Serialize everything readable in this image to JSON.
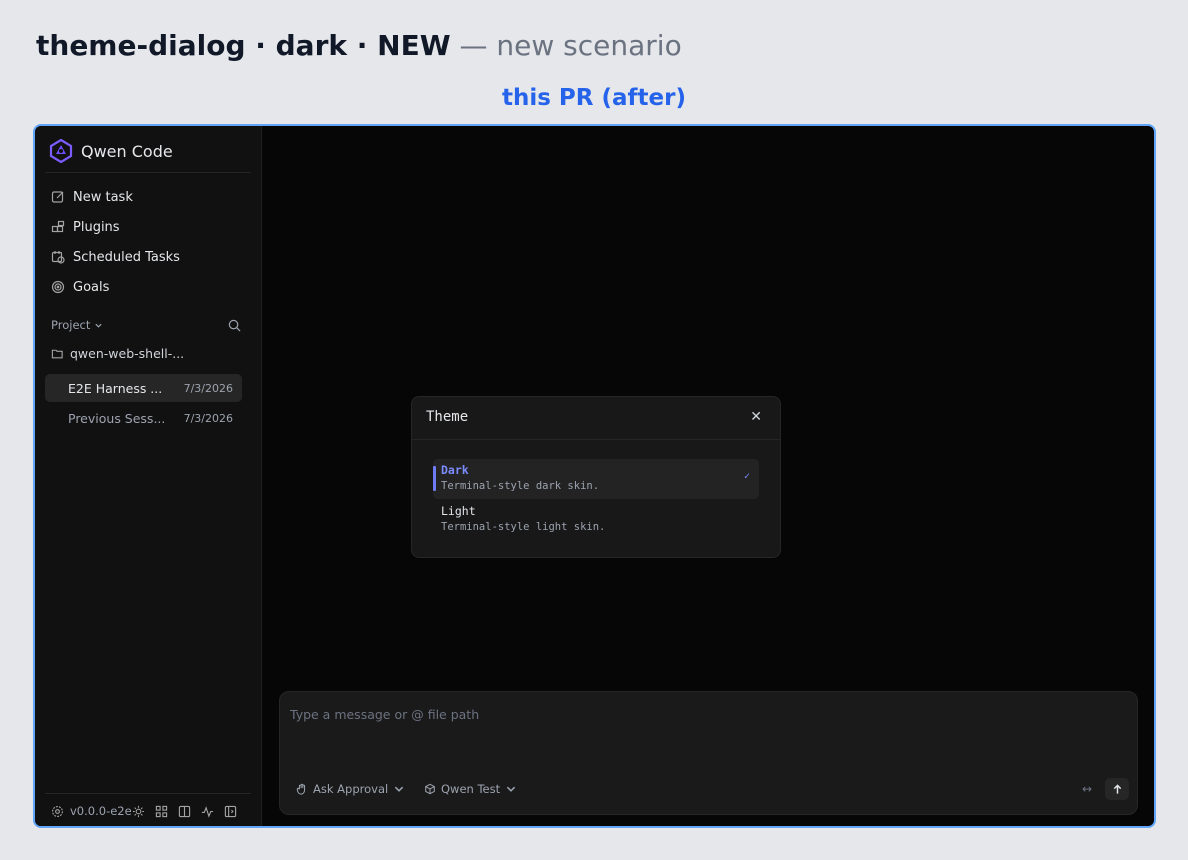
{
  "page": {
    "heading_main": "theme-dialog · dark · NEW",
    "heading_sub": "— new scenario",
    "caption": "this PR (after)"
  },
  "app": {
    "title": "Qwen Code",
    "nav": [
      {
        "label": "New task",
        "icon": "edit-icon"
      },
      {
        "label": "Plugins",
        "icon": "plugins-icon"
      },
      {
        "label": "Scheduled Tasks",
        "icon": "calendar-clock-icon"
      },
      {
        "label": "Goals",
        "icon": "target-icon"
      }
    ],
    "project": {
      "label": "Project",
      "folder": "qwen-web-shell-...",
      "sessions": [
        {
          "title": "E2E Harness ...",
          "date": "7/3/2026",
          "active": true
        },
        {
          "title": "Previous Sess...",
          "date": "7/3/2026",
          "active": false
        }
      ]
    },
    "footer": {
      "version": "v0.0.0-e2e"
    }
  },
  "dialog": {
    "title": "Theme",
    "close_label": "✕",
    "options": [
      {
        "name": "Dark",
        "description": "Terminal-style dark skin.",
        "selected": true,
        "check": "✓"
      },
      {
        "name": "Light",
        "description": "Terminal-style light skin.",
        "selected": false
      }
    ]
  },
  "composer": {
    "placeholder": "Type a message or @ file path",
    "approval_label": "Ask Approval",
    "model_label": "Qwen Test",
    "expand_glyph": "↔",
    "send_glyph": "↑"
  },
  "colors": {
    "accent": "#7c8cff",
    "frame_border": "#60a5fa",
    "caption": "#2563eb"
  }
}
